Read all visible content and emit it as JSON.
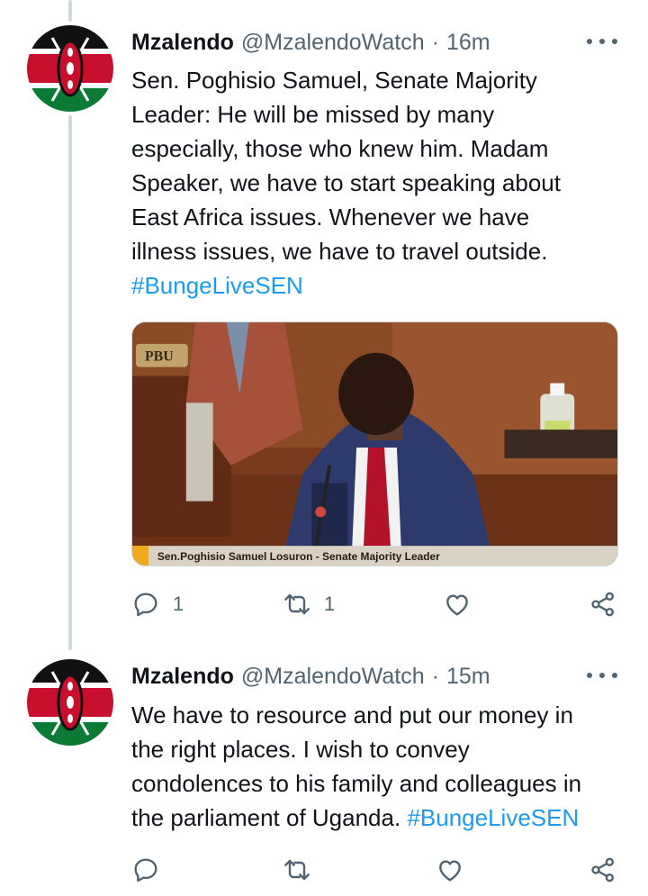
{
  "tweets": [
    {
      "name": "Mzalendo",
      "handle": "@MzalendoWatch",
      "separator": "·",
      "time": "16m",
      "text_lines": [
        "Sen. Poghisio Samuel, Senate Majority",
        "Leader: He will be missed by many",
        "especially, those who knew him. Madam",
        "Speaker, we have to start speaking about",
        "East Africa issues. Whenever we have",
        "illness issues, we have to travel outside."
      ],
      "hashtag": "#BungeLiveSEN",
      "media": {
        "logo": "PBU",
        "caption": "Sen.Poghisio Samuel Losuron - Senate Majority Leader"
      },
      "reply_count": "1",
      "retweet_count": "1",
      "like_count": ""
    },
    {
      "name": "Mzalendo",
      "handle": "@MzalendoWatch",
      "separator": "·",
      "time": "15m",
      "text_lines": [
        "We have to resource and put our money in",
        "the right places. I wish to convey",
        "condolences to his family and colleagues in",
        "the parliament of Uganda."
      ],
      "hashtag": "#BungeLiveSEN",
      "reply_count": "",
      "retweet_count": "",
      "like_count": ""
    }
  ],
  "colors": {
    "accent": "#1d9bf0",
    "muted": "#536471",
    "thread_line": "#cfd9de"
  },
  "icons": [
    "reply-icon",
    "retweet-icon",
    "like-icon",
    "share-icon",
    "more-icon"
  ]
}
